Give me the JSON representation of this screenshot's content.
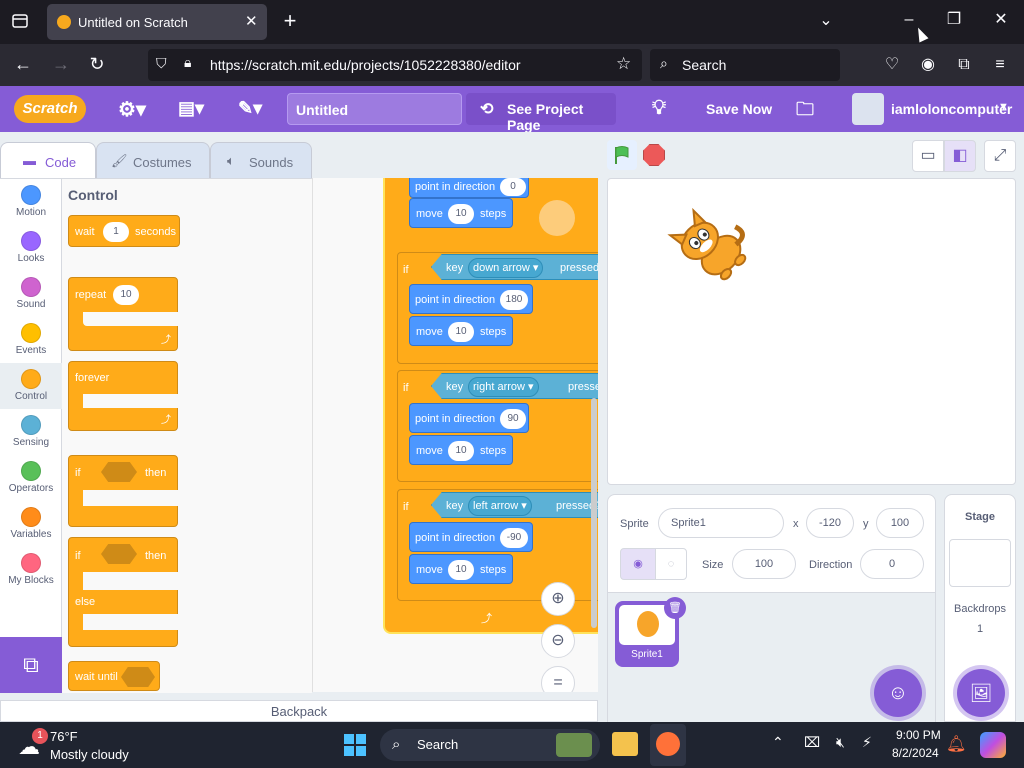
{
  "browser": {
    "tab_title": "Untitled on Scratch",
    "url": "https://scratch.mit.edu/projects/1052228380/editor",
    "search_placeholder": "Search"
  },
  "menu": {
    "logo": "Scratch",
    "project_title": "Untitled",
    "see_project_page": "See Project Page",
    "save_now": "Save Now",
    "username": "iamloloncomputer"
  },
  "editor_tabs": [
    "Code",
    "Costumes",
    "Sounds"
  ],
  "categories": [
    {
      "label": "Motion",
      "color": "#4c97ff"
    },
    {
      "label": "Looks",
      "color": "#9966ff"
    },
    {
      "label": "Sound",
      "color": "#cf63cf"
    },
    {
      "label": "Events",
      "color": "#ffbf00"
    },
    {
      "label": "Control",
      "color": "#ffab19"
    },
    {
      "label": "Sensing",
      "color": "#5cb1d6"
    },
    {
      "label": "Operators",
      "color": "#59c059"
    },
    {
      "label": "Variables",
      "color": "#ff8c1a"
    },
    {
      "label": "My Blocks",
      "color": "#ff6680"
    }
  ],
  "palette": {
    "heading": "Control",
    "wait": "wait",
    "wait_value": "1",
    "seconds": "seconds",
    "repeat": "repeat",
    "repeat_value": "10",
    "forever": "forever",
    "if": "if",
    "then": "then",
    "else": "else",
    "wait_until": "wait until"
  },
  "script": {
    "point_in_direction": "point in direction",
    "move": "move",
    "steps": "steps",
    "if": "if",
    "key": "key",
    "pressed": "pressed?",
    "top_direction": "0",
    "groups": [
      {
        "key": "down arrow",
        "direction": "180",
        "steps": "10"
      },
      {
        "key": "right arrow",
        "direction": "90",
        "steps": "10"
      },
      {
        "key": "left arrow",
        "direction": "-90",
        "steps": "10"
      }
    ],
    "top_steps": "10"
  },
  "sprite_info": {
    "sprite_label": "Sprite",
    "sprite_name": "Sprite1",
    "x_label": "x",
    "x": "-120",
    "y_label": "y",
    "y": "100",
    "size_label": "Size",
    "size": "100",
    "direction_label": "Direction",
    "direction": "0",
    "thumb_name": "Sprite1"
  },
  "stage_panel": {
    "title": "Stage",
    "backdrops_label": "Backdrops",
    "backdrops_count": "1"
  },
  "backpack": "Backpack",
  "taskbar": {
    "temp": "76°F",
    "weather": "Mostly cloudy",
    "badge": "1",
    "search": "Search",
    "time": "9:00 PM",
    "date": "8/2/2024"
  }
}
